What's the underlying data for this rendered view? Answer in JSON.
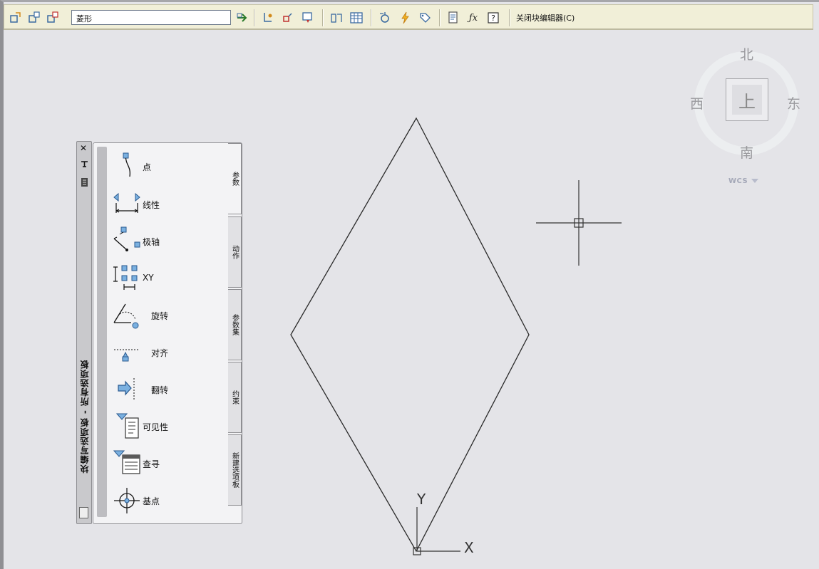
{
  "toolbar": {
    "block_name": "菱形",
    "close_editor_label": "关闭块编辑器(C)",
    "buttons": [
      "edit-block",
      "save-block",
      "save-block-as",
      "apply",
      "parameter",
      "action",
      "attribute",
      "define-visibility",
      "visibility-states",
      "update-parameter",
      "authoring-palettes",
      "block-editor-help"
    ]
  },
  "palette": {
    "title": "块编写选项板 - 所有选项板",
    "close_label": "✕",
    "items": [
      {
        "label": "点",
        "icon": "point-parameter-icon"
      },
      {
        "label": "线性",
        "icon": "linear-parameter-icon"
      },
      {
        "label": "极轴",
        "icon": "polar-parameter-icon"
      },
      {
        "label": "XY",
        "icon": "xy-parameter-icon"
      },
      {
        "label": "旋转",
        "icon": "rotation-parameter-icon"
      },
      {
        "label": "对齐",
        "icon": "alignment-parameter-icon"
      },
      {
        "label": "翻转",
        "icon": "flip-parameter-icon"
      },
      {
        "label": "可见性",
        "icon": "visibility-parameter-icon"
      },
      {
        "label": "查寻",
        "icon": "lookup-parameter-icon"
      },
      {
        "label": "基点",
        "icon": "basepoint-parameter-icon"
      }
    ],
    "tabs": [
      "参数",
      "动作",
      "参数集",
      "约束",
      "新建选项板"
    ]
  },
  "viewcube": {
    "north": "北",
    "south": "南",
    "east": "东",
    "west": "西",
    "top": "上",
    "wcs": "WCS"
  },
  "ucs": {
    "x_label": "X",
    "y_label": "Y"
  }
}
